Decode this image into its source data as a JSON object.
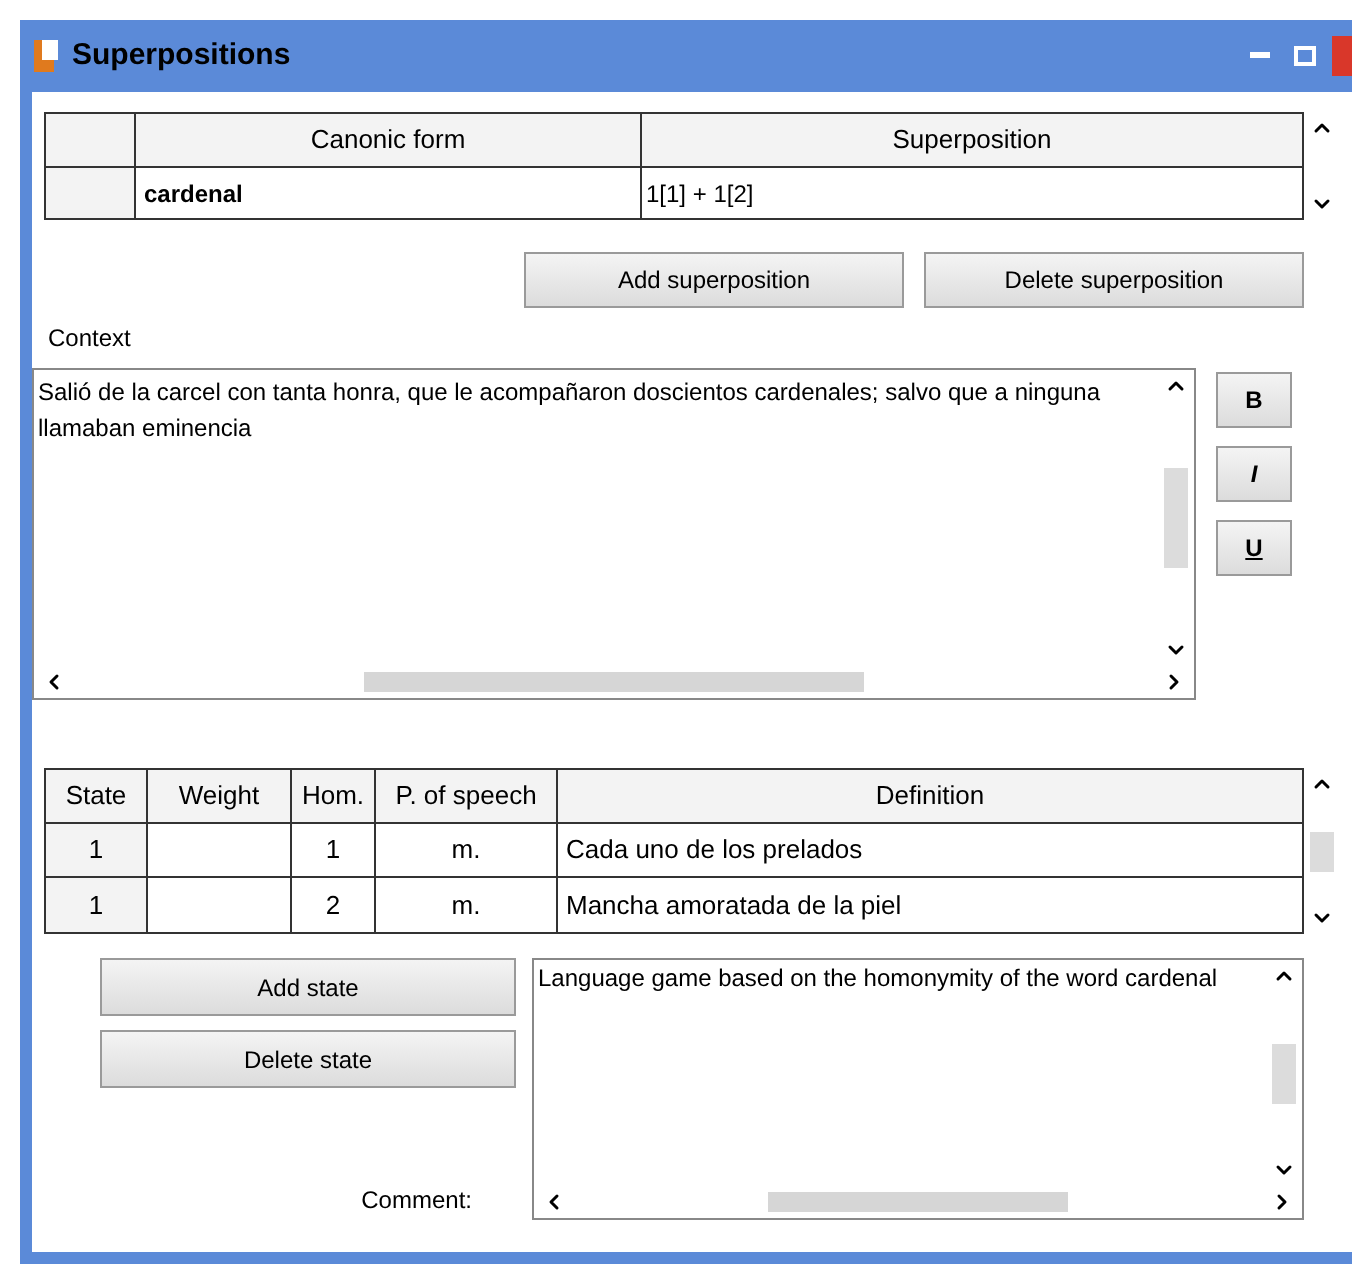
{
  "window": {
    "title": "Superpositions"
  },
  "superpositions": {
    "columns": [
      "Canonic form",
      "Superposition"
    ],
    "rows": [
      {
        "canonic_form": "cardenal",
        "superposition": "1[1] + 1[2]"
      }
    ]
  },
  "buttons": [
    "Add superposition",
    "Delete superposition"
  ],
  "context": {
    "label": "Context",
    "text": "Salió de la carcel con tanta honra, que le acompañaron doscientos cardenales; salvo que a ninguna llamaban eminencia"
  },
  "format_buttons": [
    "B",
    "I",
    "U"
  ],
  "states": {
    "columns": [
      "State",
      "Weight",
      "Hom.",
      "P. of speech",
      "Definition"
    ],
    "rows": [
      [
        "1",
        "",
        "1",
        "m.",
        "Cada uno de los prelados"
      ],
      [
        "1",
        "",
        "2",
        "m.",
        "Mancha amoratada de la piel"
      ]
    ]
  },
  "state_buttons": [
    "Add state",
    "Delete state"
  ],
  "comment": {
    "label": "Comment:",
    "text": "Language game based on the homonymity of the word cardenal"
  }
}
